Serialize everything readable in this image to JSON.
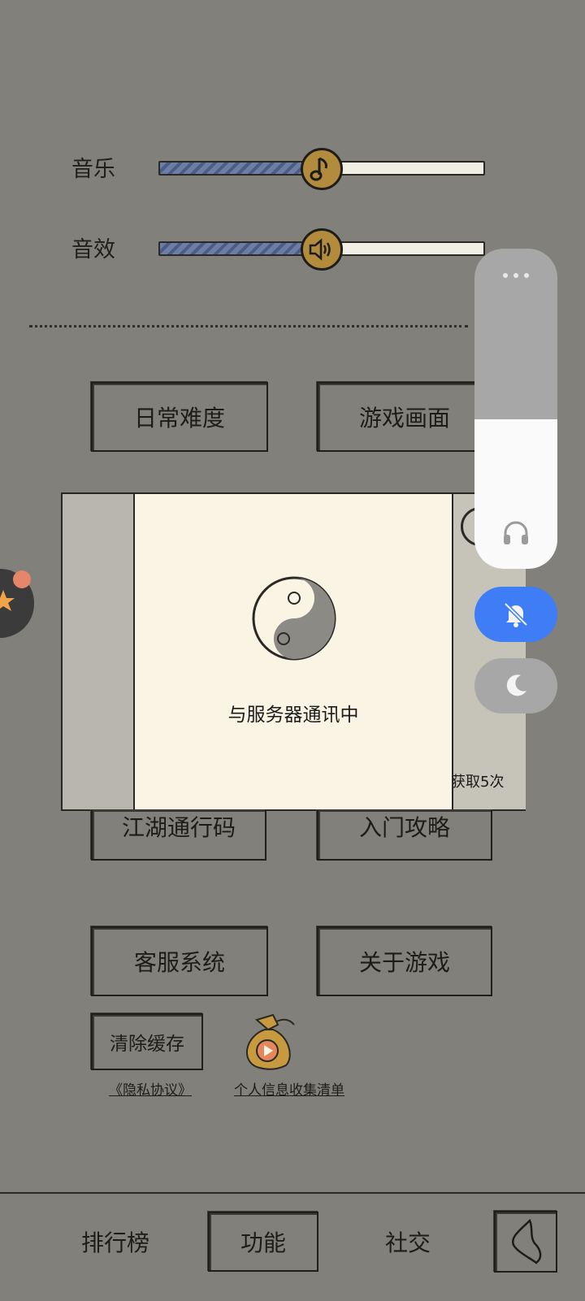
{
  "sliders": {
    "music": {
      "label": "音乐",
      "level": 0.42,
      "icon": "music-note-icon"
    },
    "sfx": {
      "label": "音效",
      "level": 0.42,
      "icon": "speaker-icon"
    }
  },
  "buttons": {
    "daily_difficulty": "日常难度",
    "game_graphics": "游戏画面",
    "jianghu_code": "江湖通行码",
    "beginner_guide": "入门攻略",
    "customer_service": "客服系统",
    "about_game": "关于游戏",
    "clear_cache": "清除缓存"
  },
  "links": {
    "privacy": "《隐私协议》",
    "personal_info": "个人信息收集清单"
  },
  "underlying_dialog": {
    "partial_text": "获取5次"
  },
  "loading": {
    "icon": "yin-yang-icon",
    "text": "与服务器通讯中"
  },
  "volume_panel": {
    "level": 0.47,
    "more_icon": "more-dots-icon",
    "output_icon": "headphones-icon",
    "mute_icon": "bell-off-icon",
    "dnd_icon": "moon-icon",
    "accent": "#3e7df5"
  },
  "nav": {
    "leaderboard": "排行榜",
    "features": "功能",
    "social": "社交"
  },
  "colors": {
    "background": "#82807a",
    "card": "#f9f4e4",
    "knob": "#b28c3c"
  }
}
